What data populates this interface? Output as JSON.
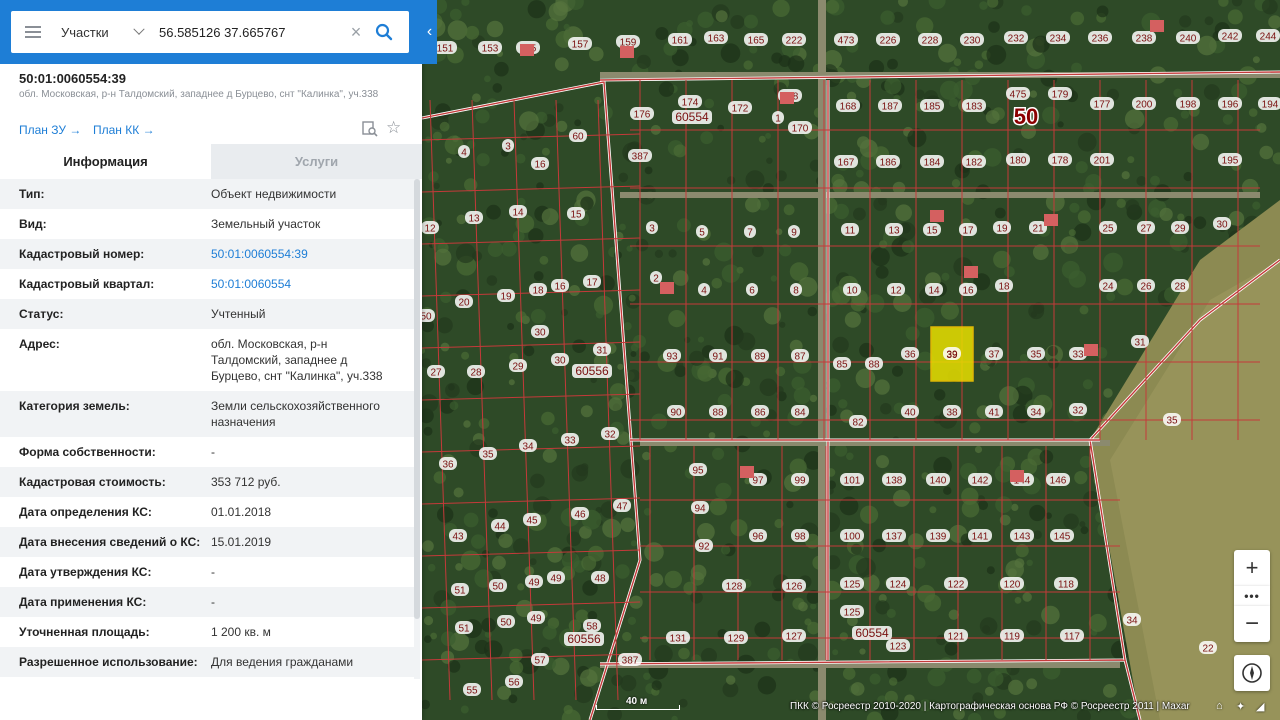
{
  "search": {
    "type_label": "Участки",
    "query": "56.585126 37.665767"
  },
  "parcel": {
    "title": "50:01:0060554:39",
    "address_short": "обл. Московская, р-н Талдомский, западнее д Бурцево, снт \"Калинка\", уч.338",
    "plan_zu": "План ЗУ →",
    "plan_kk": "План КК →"
  },
  "tabs": {
    "info": "Информация",
    "services": "Услуги"
  },
  "info_rows": [
    {
      "k": "Тип:",
      "v": "Объект недвижимости"
    },
    {
      "k": "Вид:",
      "v": "Земельный участок"
    },
    {
      "k": "Кадастровый номер:",
      "v": "50:01:0060554:39"
    },
    {
      "k": "Кадастровый квартал:",
      "v": "50:01:0060554"
    },
    {
      "k": "Статус:",
      "v": "Учтенный"
    },
    {
      "k": "Адрес:",
      "v": "обл. Московская, р-н Талдомский, западнее д Бурцево, снт \"Калинка\", уч.338"
    },
    {
      "k": "Категория земель:",
      "v": "Земли сельскохозяйственного назначения"
    },
    {
      "k": "Форма собственности:",
      "v": "-"
    },
    {
      "k": "Кадастровая стоимость:",
      "v": "353 712 руб."
    },
    {
      "k": "Дата определения КС:",
      "v": "01.01.2018"
    },
    {
      "k": "Дата внесения сведений о КС:",
      "v": "15.01.2019"
    },
    {
      "k": "Дата утверждения КС:",
      "v": "-"
    },
    {
      "k": "Дата применения КС:",
      "v": "-"
    },
    {
      "k": "Уточненная площадь:",
      "v": "1 200 кв. м"
    },
    {
      "k": "Разрешенное использование:",
      "v": "Для ведения гражданами"
    }
  ],
  "map": {
    "selected_plot": "39",
    "quarter_labels": [
      "60554",
      "60556",
      "60556",
      "60554"
    ],
    "big_label": "50",
    "plot_labels": [
      "151",
      "153",
      "155",
      "157",
      "159",
      "161",
      "163",
      "165",
      "222",
      "473",
      "226",
      "228",
      "230",
      "232",
      "234",
      "236",
      "238",
      "240",
      "242",
      "244",
      "174",
      "172",
      "528",
      "1",
      "170",
      "168",
      "187",
      "185",
      "183",
      "475",
      "179",
      "177",
      "200",
      "198",
      "196",
      "194",
      "176",
      "167",
      "186",
      "184",
      "182",
      "180",
      "178",
      "201",
      "195",
      "387",
      "4",
      "3",
      "60",
      "16",
      "13",
      "14",
      "15",
      "12",
      "3",
      "5",
      "7",
      "9",
      "11",
      "13",
      "15",
      "17",
      "19",
      "21",
      "25",
      "27",
      "29",
      "30",
      "2",
      "4",
      "6",
      "8",
      "10",
      "12",
      "14",
      "16",
      "18",
      "24",
      "26",
      "28",
      "20",
      "19",
      "18",
      "16",
      "17",
      "50",
      "30",
      "93",
      "91",
      "89",
      "87",
      "85",
      "88",
      "36",
      "39",
      "37",
      "35",
      "33",
      "31",
      "27",
      "28",
      "29",
      "30",
      "31",
      "90",
      "88",
      "86",
      "84",
      "82",
      "40",
      "38",
      "41",
      "34",
      "32",
      "36",
      "35",
      "34",
      "33",
      "32",
      "95",
      "97",
      "99",
      "101",
      "138",
      "140",
      "142",
      "144",
      "146",
      "35",
      "94",
      "43",
      "44",
      "45",
      "46",
      "47",
      "92",
      "96",
      "98",
      "100",
      "137",
      "139",
      "141",
      "143",
      "145",
      "51",
      "50",
      "49",
      "49",
      "48",
      "128",
      "126",
      "125",
      "124",
      "122",
      "120",
      "118",
      "51",
      "50",
      "49",
      "58",
      "131",
      "129",
      "127",
      "125",
      "123",
      "121",
      "119",
      "117",
      "34",
      "55",
      "56",
      "57",
      "387",
      "22"
    ],
    "scale_label": "40 м",
    "copyright": "ПКК © Росреестр 2010-2020 | Картографическая основа РФ © Росреестр 2011 | Maxar"
  },
  "controls": {
    "zoom_in": "+",
    "zoom_more": "•••",
    "zoom_out": "−"
  },
  "colors": {
    "accent": "#1e7ed6",
    "boundary": "#c43a3a",
    "selected_fill": "#e8e000"
  }
}
